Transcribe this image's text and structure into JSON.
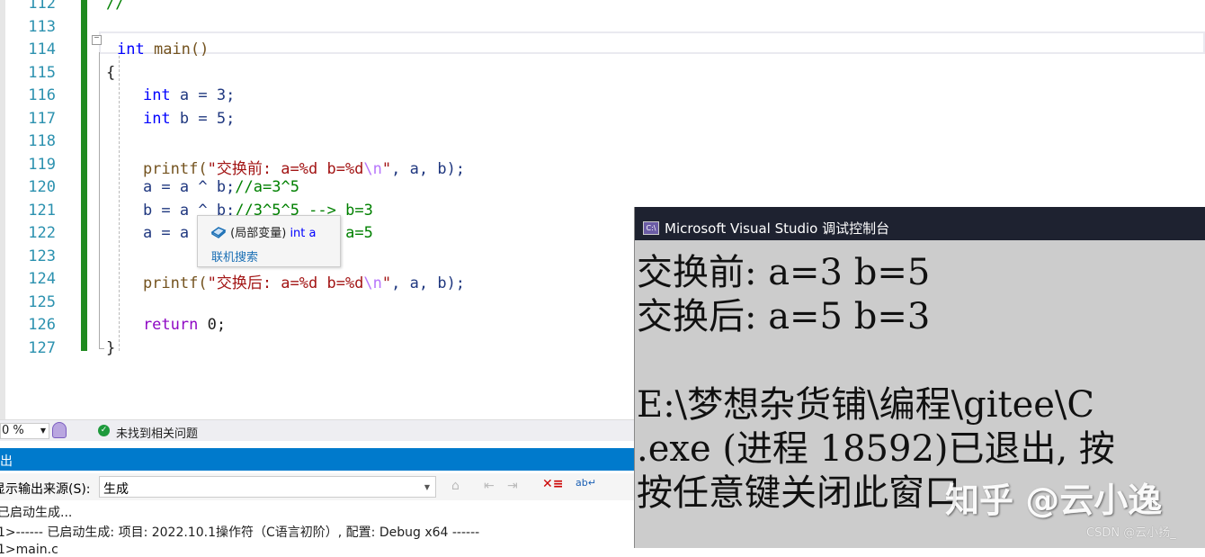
{
  "editor": {
    "line_numbers": [
      "112",
      "113",
      "114",
      "115",
      "116",
      "117",
      "118",
      "119",
      "120",
      "121",
      "122",
      "123",
      "124",
      "125",
      "126",
      "127"
    ],
    "lines": [
      [
        {
          "t": "//",
          "c": "cm"
        }
      ],
      [],
      [
        {
          "t": "int",
          "c": "kw"
        },
        {
          "t": " main()",
          "c": "fn"
        }
      ],
      [
        {
          "t": "{",
          "c": ""
        }
      ],
      [
        {
          "t": "    ",
          "c": ""
        },
        {
          "t": "int",
          "c": "kw"
        },
        {
          "t": " a = 3;",
          "c": "id"
        }
      ],
      [
        {
          "t": "    ",
          "c": ""
        },
        {
          "t": "int",
          "c": "kw"
        },
        {
          "t": " b = 5;",
          "c": "id"
        }
      ],
      [],
      [
        {
          "t": "    printf(",
          "c": "fn"
        },
        {
          "t": "\"交换前: a=%d b=%d",
          "c": "str"
        },
        {
          "t": "\\n",
          "c": "esc"
        },
        {
          "t": "\"",
          "c": "str"
        },
        {
          "t": ", a, b);",
          "c": "id"
        }
      ],
      [
        {
          "t": "    a = a ^ b;",
          "c": "id"
        },
        {
          "t": "//a=3^5",
          "c": "cm"
        }
      ],
      [
        {
          "t": "    b = a ^ b;",
          "c": "id"
        },
        {
          "t": "//3^5^5 --> b=3",
          "c": "cm"
        }
      ],
      [
        {
          "t": "    a = a ^ b;",
          "c": "id"
        },
        {
          "t": "//3^5^3 --> a=5",
          "c": "cm"
        }
      ],
      [],
      [
        {
          "t": "    printf(",
          "c": "fn"
        },
        {
          "t": "\"交换后: a=%d b=%d",
          "c": "str"
        },
        {
          "t": "\\n",
          "c": "esc"
        },
        {
          "t": "\"",
          "c": "str"
        },
        {
          "t": ", a, b);",
          "c": "id"
        }
      ],
      [],
      [
        {
          "t": "    return",
          "c": "ret"
        },
        {
          "t": " 0;",
          "c": ""
        }
      ],
      [
        {
          "t": "}",
          "c": ""
        }
      ]
    ]
  },
  "tooltip": {
    "icon": "local-variable-icon",
    "scope": "(局部变量)",
    "type": "int",
    "name": " a",
    "link": "联机搜索"
  },
  "status": {
    "zoom": "0 %",
    "issues_icon": "check-circle-icon",
    "issues": "未找到相关问题"
  },
  "output": {
    "title": "出",
    "source_label": "显示输出来源(S):",
    "source_value": "生成",
    "lines": [
      "已启动生成...",
      "1>------ 已启动生成: 项目: 2022.10.1操作符（C语言初阶）, 配置: Debug x64 ------",
      "1>main.c"
    ]
  },
  "console": {
    "title": "Microsoft Visual Studio 调试控制台",
    "lines": [
      "交换前: a=3 b=5",
      "交换后: a=5 b=3",
      "",
      "E:\\梦想杂货铺\\编程\\gitee\\C",
      ".exe (进程 18592)已退出, 按",
      "按任意键关闭此窗口"
    ],
    "watermark": "知乎 @云小逸",
    "watermark2": "CSDN @云小扬_"
  },
  "colors": {
    "accent": "#007acc",
    "gutter_green": "#1f8a1f",
    "console_bg": "#cccccc"
  }
}
